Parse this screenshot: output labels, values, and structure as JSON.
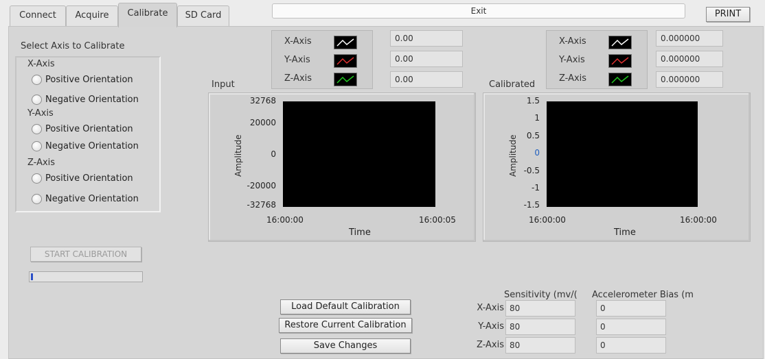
{
  "tabs": [
    "Connect",
    "Acquire",
    "Calibrate",
    "SD Card"
  ],
  "active_tab": "Calibrate",
  "exit_label": "Exit",
  "print_label": "PRINT",
  "calibrate": {
    "select_title": "Select Axis to Calibrate",
    "groups": [
      {
        "axis": "X-Axis",
        "options": [
          "Positive Orientation",
          "Negative Orientation"
        ]
      },
      {
        "axis": "Y-Axis",
        "options": [
          "Positive Orientation",
          "Negative Orientation"
        ]
      },
      {
        "axis": "Z-Axis",
        "options": [
          "Positive Orientation",
          "Negative Orientation"
        ]
      }
    ],
    "start_button": "START CALIBRATION",
    "progress": 0.02
  },
  "input_graph": {
    "title": "Input",
    "legend": [
      {
        "name": "X-Axis",
        "color": "#ffffff",
        "value": "0.00"
      },
      {
        "name": "Y-Axis",
        "color": "#e03030",
        "value": "0.00"
      },
      {
        "name": "Z-Axis",
        "color": "#22cc22",
        "value": "0.00"
      }
    ],
    "y_ticks": [
      "32768",
      "20000",
      "0",
      "-20000",
      "-32768"
    ],
    "x_ticks": [
      "16:00:00",
      "16:00:05"
    ],
    "xlabel": "Time",
    "ylabel": "Amplitude"
  },
  "calibrated_graph": {
    "title": "Calibrated",
    "legend": [
      {
        "name": "X-Axis",
        "color": "#ffffff",
        "value": "0.000000"
      },
      {
        "name": "Y-Axis",
        "color": "#e03030",
        "value": "0.000000"
      },
      {
        "name": "Z-Axis",
        "color": "#22cc22",
        "value": "0.000000"
      }
    ],
    "y_ticks": [
      "1.5",
      "1",
      "0.5",
      "0",
      "-0.5",
      "-1",
      "-1.5"
    ],
    "x_ticks": [
      "16:00:00",
      "16:00:00"
    ],
    "xlabel": "Time",
    "ylabel": "Amplitude"
  },
  "buttons": {
    "load_default": "Load Default Calibration",
    "restore_current": "Restore Current Calibration",
    "save_changes": "Save Changes"
  },
  "table": {
    "sensitivity_header": "Sensitivity (mv/(",
    "bias_header": "Accelerometer Bias (m",
    "rows": [
      {
        "axis": "X-Axis",
        "sensitivity": "80",
        "bias": "0"
      },
      {
        "axis": "Y-Axis",
        "sensitivity": "80",
        "bias": "0"
      },
      {
        "axis": "Z-Axis",
        "sensitivity": "80",
        "bias": "0"
      }
    ]
  }
}
